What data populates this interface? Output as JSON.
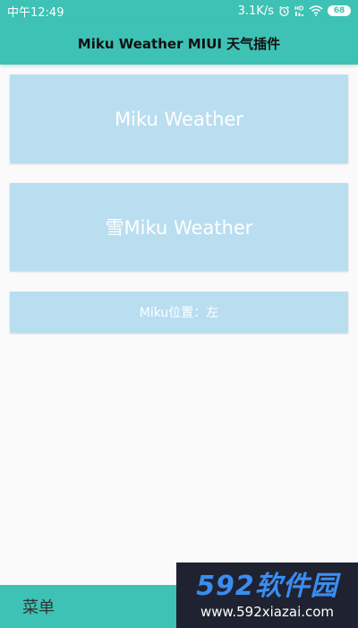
{
  "status_bar": {
    "time": "中午12:49",
    "net_speed": "3.1K/s",
    "battery": "68",
    "icons": [
      "alarm-icon",
      "hd-icon",
      "wifi-icon",
      "battery-icon"
    ]
  },
  "app_bar": {
    "title": "Miku Weather MIUI 天气插件"
  },
  "cards": [
    {
      "label": "Miku Weather"
    },
    {
      "label": "雪Miku Weather"
    },
    {
      "label": "Miku位置：左"
    }
  ],
  "bottom_bar": {
    "menu_label": "菜单"
  },
  "watermark": {
    "logo": "592软件园",
    "url": "www.592xiazai.com"
  },
  "colors": {
    "accent": "#3dc2b5",
    "card_bg": "#b9def0",
    "background": "#fafafa"
  }
}
